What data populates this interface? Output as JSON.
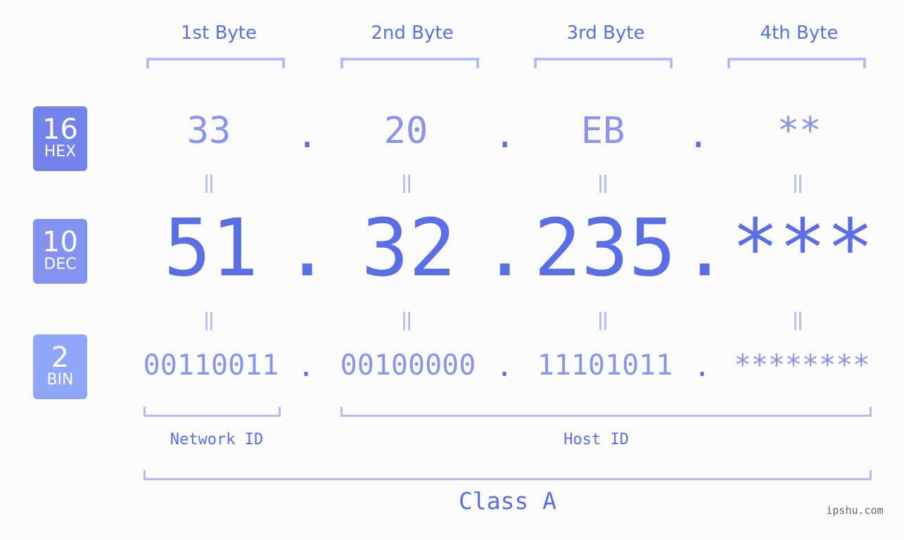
{
  "bytes": [
    {
      "label": "1st Byte",
      "hex": "33",
      "dec": "51",
      "bin": "00110011"
    },
    {
      "label": "2nd Byte",
      "hex": "20",
      "dec": "32",
      "bin": "00100000"
    },
    {
      "label": "3rd Byte",
      "hex": "EB",
      "dec": "235",
      "bin": "11101011"
    },
    {
      "label": "4th Byte",
      "hex": "**",
      "dec": "***",
      "bin": "********"
    }
  ],
  "separator": ".",
  "badges": {
    "hex": {
      "number": "16",
      "label": "HEX",
      "color": "#7383eb"
    },
    "dec": {
      "number": "10",
      "label": "DEC",
      "color": "#8493f1"
    },
    "bin": {
      "number": "2",
      "label": "BIN",
      "color": "#8fa7fb"
    }
  },
  "network_id_label": "Network ID",
  "host_id_label": "Host ID",
  "class_label": "Class A",
  "watermark": "ipshu.com",
  "colors": {
    "accent": "#5a6fe6",
    "light_value": "#8795ee",
    "bracket": "#b2bcf8"
  }
}
